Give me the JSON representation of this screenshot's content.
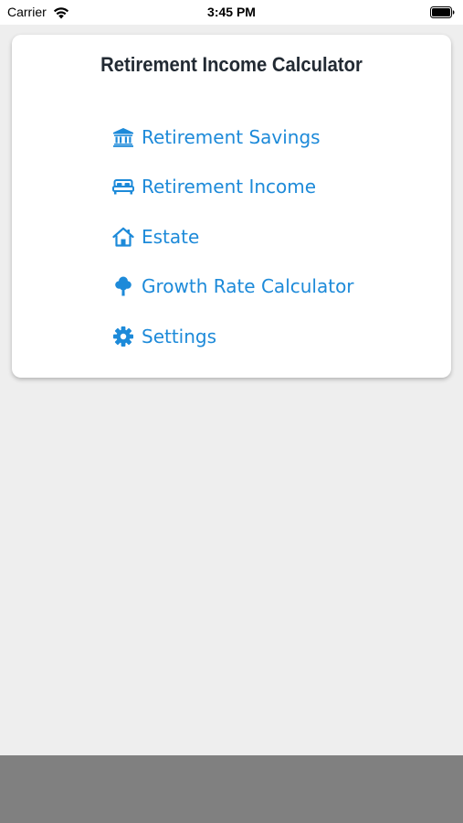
{
  "status_bar": {
    "carrier": "Carrier",
    "time": "3:45 PM",
    "icons": [
      "wifi-icon",
      "battery-icon"
    ]
  },
  "card": {
    "title": "Retirement Income Calculator"
  },
  "menu": {
    "accent_color": "#1d8ad9",
    "items": [
      {
        "label": "Retirement Savings",
        "icon": "bank-icon"
      },
      {
        "label": "Retirement Income",
        "icon": "bed-icon"
      },
      {
        "label": "Estate",
        "icon": "house-icon"
      },
      {
        "label": "Growth Rate Calculator",
        "icon": "tree-icon"
      },
      {
        "label": "Settings",
        "icon": "gear-icon"
      }
    ]
  },
  "colors": {
    "background": "#eeeeee",
    "card": "#ffffff",
    "title": "#222a33",
    "bottom_bar": "#808080"
  }
}
